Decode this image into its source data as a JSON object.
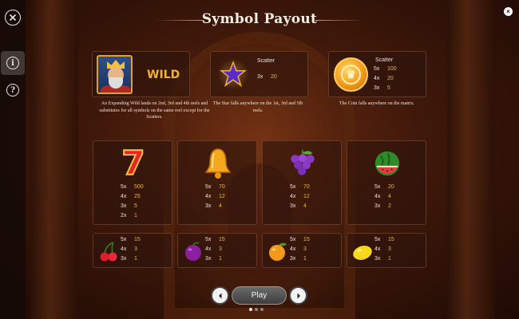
{
  "title": "Symbol Payout",
  "sidebar": {
    "close_icon": "close-icon",
    "info_icon": "info-icon",
    "help_icon": "help-icon",
    "info_glyph": "i",
    "help_glyph": "?"
  },
  "corner_close_glyph": "×",
  "wild": {
    "label": "WILD",
    "description": "An Expanding Wild lands on 2nd, 3rd and 4th reels and substitutes for all symbols on the same reel except for the Scatters."
  },
  "scatter_star": {
    "label": "Scatter",
    "payouts": [
      {
        "count": "3x",
        "value": "20"
      }
    ],
    "description": "The Star falls anywhere on the 1st, 3rd and 5th reels."
  },
  "scatter_coin": {
    "label": "Scatter",
    "payouts": [
      {
        "count": "5x",
        "value": "100"
      },
      {
        "count": "4x",
        "value": "20"
      },
      {
        "count": "3x",
        "value": "5"
      }
    ],
    "description": "The Coin falls anywhere on the matrix.",
    "coin_glyph": "♛"
  },
  "high_symbols": [
    {
      "name": "seven",
      "payouts": [
        {
          "count": "5x",
          "value": "500"
        },
        {
          "count": "4x",
          "value": "25"
        },
        {
          "count": "3x",
          "value": "5"
        },
        {
          "count": "2x",
          "value": "1"
        }
      ]
    },
    {
      "name": "bell",
      "payouts": [
        {
          "count": "5x",
          "value": "70"
        },
        {
          "count": "4x",
          "value": "12"
        },
        {
          "count": "3x",
          "value": "4"
        }
      ]
    },
    {
      "name": "grapes",
      "payouts": [
        {
          "count": "5x",
          "value": "70"
        },
        {
          "count": "4x",
          "value": "12"
        },
        {
          "count": "3x",
          "value": "4"
        }
      ]
    },
    {
      "name": "watermelon",
      "payouts": [
        {
          "count": "5x",
          "value": "20"
        },
        {
          "count": "4x",
          "value": "4"
        },
        {
          "count": "3x",
          "value": "2"
        }
      ]
    }
  ],
  "low_symbols": [
    {
      "name": "cherries",
      "payouts": [
        {
          "count": "5x",
          "value": "15"
        },
        {
          "count": "4x",
          "value": "3"
        },
        {
          "count": "3x",
          "value": "1"
        }
      ]
    },
    {
      "name": "plum",
      "payouts": [
        {
          "count": "5x",
          "value": "15"
        },
        {
          "count": "4x",
          "value": "3"
        },
        {
          "count": "3x",
          "value": "1"
        }
      ]
    },
    {
      "name": "orange",
      "payouts": [
        {
          "count": "5x",
          "value": "15"
        },
        {
          "count": "4x",
          "value": "3"
        },
        {
          "count": "3x",
          "value": "1"
        }
      ]
    },
    {
      "name": "lemon",
      "payouts": [
        {
          "count": "5x",
          "value": "15"
        },
        {
          "count": "4x",
          "value": "3"
        },
        {
          "count": "3x",
          "value": "1"
        }
      ]
    }
  ],
  "nav": {
    "play_label": "Play",
    "seven_glyph": "7",
    "page_count": 3,
    "active_page": 1
  },
  "colors": {
    "payout_value": "#f0b52c",
    "wild_text": "#f0b52c",
    "background": "#3f180a"
  }
}
